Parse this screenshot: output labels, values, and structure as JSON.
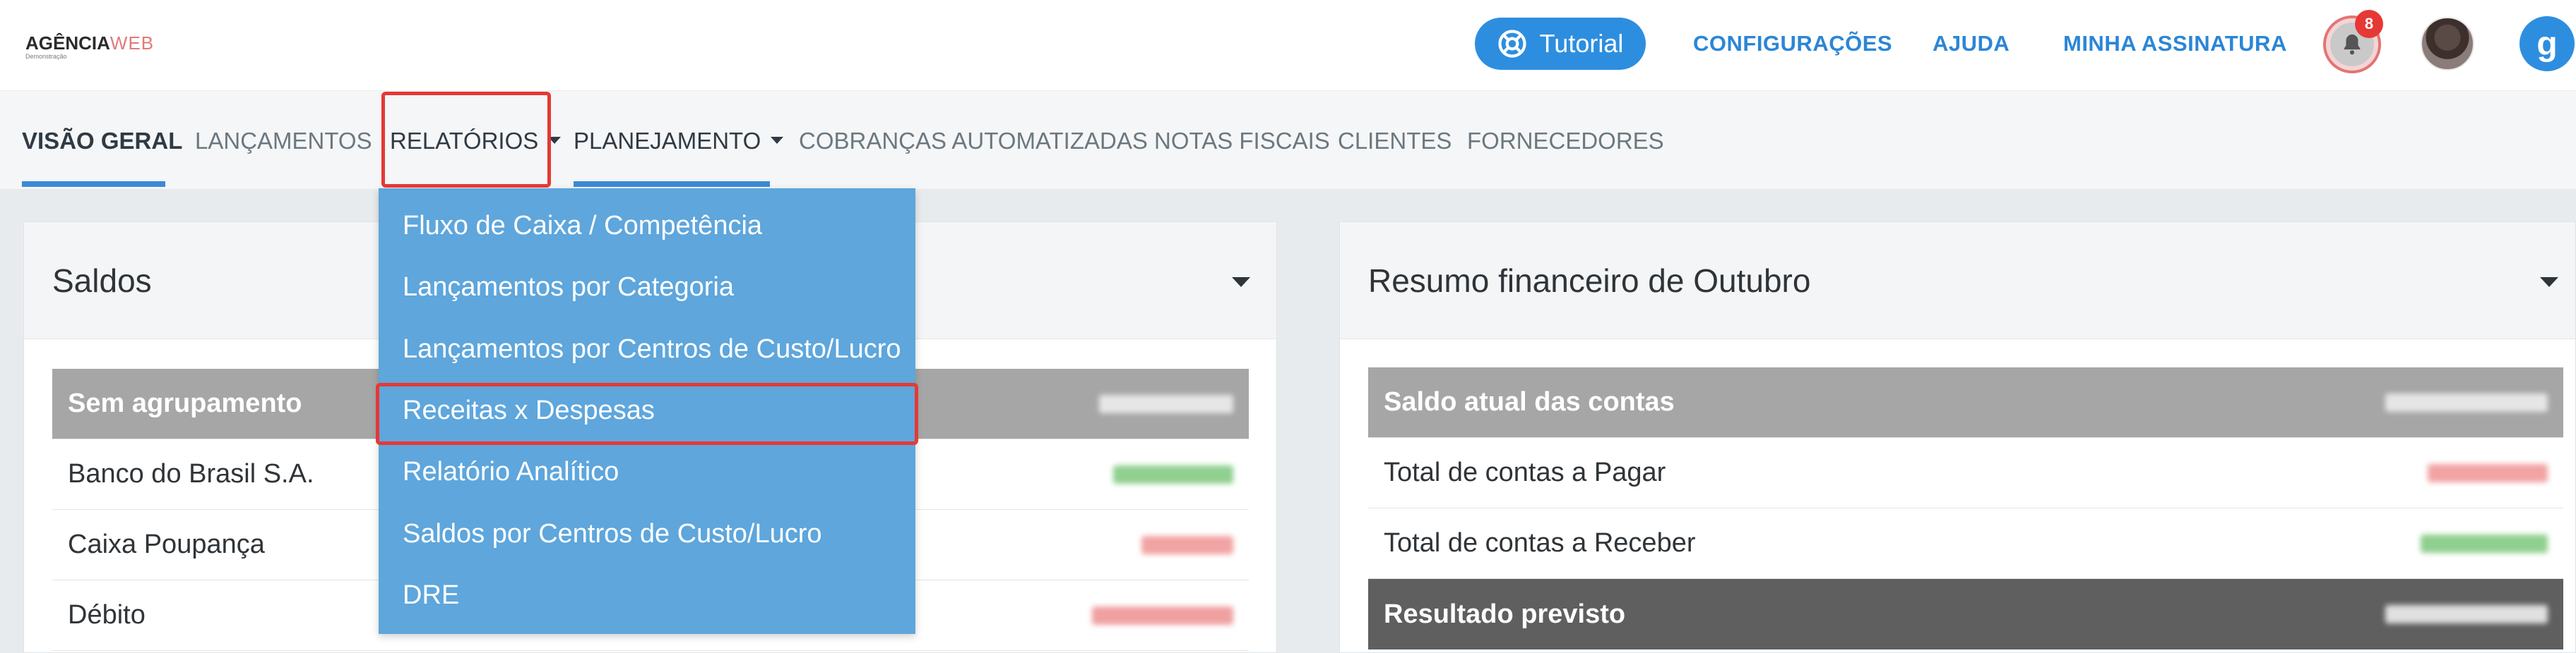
{
  "header": {
    "logo_brand": "AGÊNCIA",
    "logo_brand_suffix": "WEB",
    "logo_subtitle": "Demonstração",
    "tutorial_label": "Tutorial",
    "links": [
      "CONFIGURAÇÕES",
      "AJUDA",
      "MINHA ASSINATURA"
    ],
    "notification_count": "8",
    "profile_letter": "g"
  },
  "nav": {
    "items": [
      {
        "label": "VISÃO GERAL"
      },
      {
        "label": "LANÇAMENTOS"
      },
      {
        "label": "RELATÓRIOS"
      },
      {
        "label": "PLANEJAMENTO"
      },
      {
        "label": "COBRANÇAS AUTOMATIZADAS"
      },
      {
        "label": "NOTAS FISCAIS"
      },
      {
        "label": "CLIENTES"
      },
      {
        "label": "FORNECEDORES"
      }
    ]
  },
  "dropdown": {
    "items": [
      {
        "label": "Fluxo de Caixa / Competência"
      },
      {
        "label": "Lançamentos por Categoria"
      },
      {
        "label": "Lançamentos por Centros de Custo/Lucro"
      },
      {
        "label": "Receitas x Despesas"
      },
      {
        "label": "Relatório Analítico"
      },
      {
        "label": "Saldos por Centros de Custo/Lucro"
      },
      {
        "label": "DRE"
      }
    ]
  },
  "saldos": {
    "title": "Saldos",
    "rows": [
      {
        "label": "Sem agrupamento"
      },
      {
        "label": "Banco do Brasil S.A."
      },
      {
        "label": "Caixa Poupança"
      },
      {
        "label": "Débito"
      }
    ]
  },
  "resumo": {
    "title": "Resumo financeiro de Outubro",
    "rows": [
      {
        "label": "Saldo atual das contas"
      },
      {
        "label": "Total de contas a Pagar"
      },
      {
        "label": "Total de contas a Receber"
      },
      {
        "label": "Resultado previsto"
      }
    ]
  },
  "colors": {
    "accent": "#2d8ee0",
    "dropdown_bg": "#5ea6dc",
    "highlight": "#e53935",
    "positive": "#5cb85c",
    "negative": "#e57373"
  }
}
